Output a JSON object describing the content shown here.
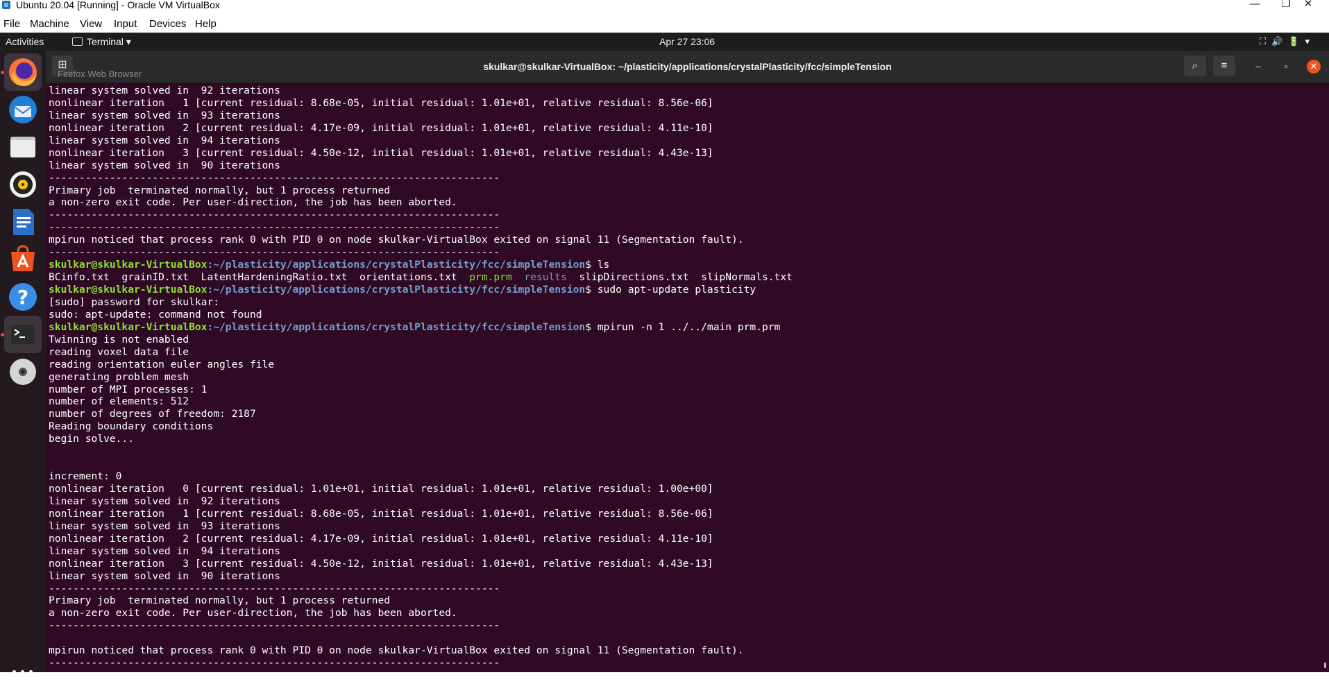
{
  "host": {
    "title": "Ubuntu 20.04  [Running] - Oracle VM VirtualBox",
    "window_controls": [
      "—",
      "❐",
      "✕"
    ],
    "menu": [
      "File",
      "Machine",
      "View",
      "Input",
      "Devices",
      "Help"
    ]
  },
  "topbar": {
    "activities": "Activities",
    "app_menu": "Terminal ▾",
    "clock": "Apr 27  23:06",
    "tray": "⛶🔊🔋▾"
  },
  "tooltip": "Firefox Web Browser",
  "dock_icons": [
    "firefox-icon",
    "thunderbird-icon",
    "files-icon",
    "rhythmbox-icon",
    "libreoffice-writer-icon",
    "ubuntu-software-icon",
    "help-icon",
    "terminal-icon",
    "dvd-icon",
    "show-applications-icon"
  ],
  "terminal": {
    "new_tab": "⊞",
    "title": "skulkar@skulkar-VirtualBox: ~/plasticity/applications/crystalPlasticity/fcc/simpleTension",
    "search_symbol": "⌕",
    "menu_symbol": "≡",
    "minimize_symbol": "–",
    "maximize_symbol": "▫",
    "close_symbol": "✕",
    "prompt_user": "skulkar@skulkar-VirtualBox",
    "prompt_path": ":~/plasticity/applications/crystalPlasticity/fcc/simpleTension",
    "lines_top": [
      "linear system solved in  92 iterations",
      "nonlinear iteration   1 [current residual: 8.68e-05, initial residual: 1.01e+01, relative residual: 8.56e-06]",
      "linear system solved in  93 iterations",
      "nonlinear iteration   2 [current residual: 4.17e-09, initial residual: 1.01e+01, relative residual: 4.11e-10]",
      "linear system solved in  94 iterations",
      "nonlinear iteration   3 [current residual: 4.50e-12, initial residual: 1.01e+01, relative residual: 4.43e-13]",
      "linear system solved in  90 iterations",
      "--------------------------------------------------------------------------",
      "Primary job  terminated normally, but 1 process returned",
      "a non-zero exit code. Per user-direction, the job has been aborted.",
      "--------------------------------------------------------------------------",
      "--------------------------------------------------------------------------",
      "mpirun noticed that process rank 0 with PID 0 on node skulkar-VirtualBox exited on signal 11 (Segmentation fault).",
      "--------------------------------------------------------------------------"
    ],
    "cmd1": "$ ls",
    "ls_a": "BCinfo.txt  grainID.txt  LatentHardeningRatio.txt  orientations.txt  ",
    "ls_exec": "prm.prm",
    "ls_gap": "  ",
    "ls_dir": "results",
    "ls_b": "  slipDirections.txt  slipNormals.txt",
    "cmd2": "$ sudo apt-update plasticity",
    "sudo_lines": [
      "[sudo] password for skulkar:",
      "sudo: apt-update: command not found"
    ],
    "cmd3": "$ mpirun -n 1 ../../main prm.prm",
    "lines_bottom": [
      "Twinning is not enabled",
      "reading voxel data file",
      "reading orientation euler angles file",
      "generating problem mesh",
      "number of MPI processes: 1",
      "number of elements: 512",
      "number of degrees of freedom: 2187",
      "Reading boundary conditions",
      "begin solve...",
      "",
      "",
      "increment: 0",
      "nonlinear iteration   0 [current residual: 1.01e+01, initial residual: 1.01e+01, relative residual: 1.00e+00]",
      "linear system solved in  92 iterations",
      "nonlinear iteration   1 [current residual: 8.68e-05, initial residual: 1.01e+01, relative residual: 8.56e-06]",
      "linear system solved in  93 iterations",
      "nonlinear iteration   2 [current residual: 4.17e-09, initial residual: 1.01e+01, relative residual: 4.11e-10]",
      "linear system solved in  94 iterations",
      "nonlinear iteration   3 [current residual: 4.50e-12, initial residual: 1.01e+01, relative residual: 4.43e-13]",
      "linear system solved in  90 iterations",
      "--------------------------------------------------------------------------",
      "Primary job  terminated normally, but 1 process returned",
      "a non-zero exit code. Per user-direction, the job has been aborted.",
      "--------------------------------------------------------------------------",
      "",
      "mpirun noticed that process rank 0 with PID 0 on node skulkar-VirtualBox exited on signal 11 (Segmentation fault).",
      "--------------------------------------------------------------------------"
    ]
  },
  "colors": {
    "terminal_bg": "#300a24",
    "prompt_user": "#8ae234",
    "prompt_path": "#729fcf",
    "accent": "#e95420"
  }
}
